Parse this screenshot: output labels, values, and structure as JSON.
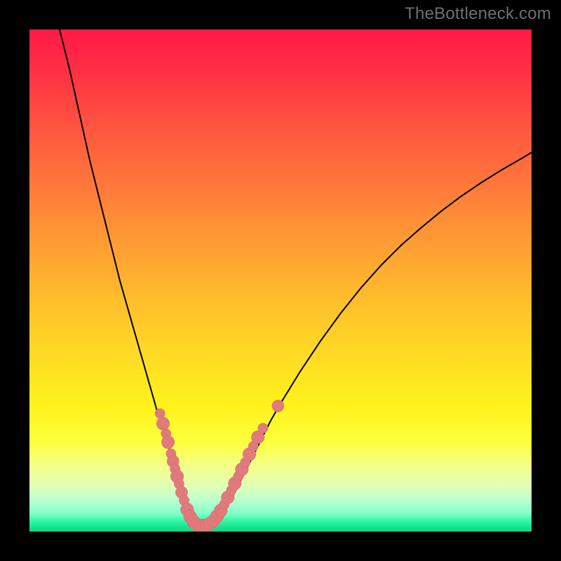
{
  "watermark": "TheBottleneck.com",
  "colors": {
    "frame": "#000000",
    "curve": "#000000",
    "marker_fill": "#e07a7c",
    "marker_stroke": "#d46b6d"
  },
  "chart_data": {
    "type": "line",
    "title": "",
    "xlabel": "",
    "ylabel": "",
    "xlim": [
      0,
      100
    ],
    "ylim": [
      0,
      100
    ],
    "grid": false,
    "legend": false,
    "series": [
      {
        "name": "curve",
        "comment": "V-shaped curve; y-values as percentage of plot height from bottom (0=bottom, 100=top). Minimum ≈ x=33, y≈1.",
        "x": [
          6,
          8,
          10,
          12,
          14,
          16,
          18,
          20,
          22,
          24,
          26,
          28,
          30,
          31,
          32,
          33,
          34,
          35,
          36,
          38,
          40,
          42,
          44,
          46,
          48,
          50,
          54,
          58,
          62,
          66,
          70,
          74,
          78,
          82,
          86,
          90,
          94,
          98,
          100
        ],
        "y": [
          100,
          92,
          83,
          74,
          66,
          58,
          50,
          43,
          36,
          29,
          22,
          16,
          9,
          6,
          3.5,
          1.5,
          1.2,
          1.2,
          1.5,
          3,
          6,
          10,
          14,
          18,
          22,
          25.5,
          32,
          38,
          43.5,
          48.5,
          53,
          57,
          60.5,
          63.8,
          66.8,
          69.5,
          72,
          74.3,
          75.5
        ]
      }
    ],
    "markers": {
      "comment": "salmon dot clusters along the V near the vertex and lower legs; same coordinate system as curve",
      "points": [
        {
          "x": 26.0,
          "y": 23.5,
          "r": 1.0
        },
        {
          "x": 26.6,
          "y": 21.5,
          "r": 1.3
        },
        {
          "x": 27.2,
          "y": 19.5,
          "r": 1.0
        },
        {
          "x": 27.6,
          "y": 17.8,
          "r": 1.3
        },
        {
          "x": 28.2,
          "y": 15.5,
          "r": 1.0
        },
        {
          "x": 28.6,
          "y": 14.0,
          "r": 1.2
        },
        {
          "x": 29.0,
          "y": 12.5,
          "r": 1.0
        },
        {
          "x": 29.4,
          "y": 11.0,
          "r": 1.3
        },
        {
          "x": 29.8,
          "y": 9.5,
          "r": 1.0
        },
        {
          "x": 30.3,
          "y": 7.8,
          "r": 1.2
        },
        {
          "x": 30.8,
          "y": 6.2,
          "r": 1.0
        },
        {
          "x": 31.4,
          "y": 4.4,
          "r": 1.3
        },
        {
          "x": 32.0,
          "y": 3.0,
          "r": 1.3
        },
        {
          "x": 32.6,
          "y": 2.0,
          "r": 1.3
        },
        {
          "x": 33.2,
          "y": 1.4,
          "r": 1.3
        },
        {
          "x": 33.9,
          "y": 1.2,
          "r": 1.3
        },
        {
          "x": 34.6,
          "y": 1.2,
          "r": 1.3
        },
        {
          "x": 35.3,
          "y": 1.3,
          "r": 1.3
        },
        {
          "x": 36.0,
          "y": 1.6,
          "r": 1.3
        },
        {
          "x": 36.7,
          "y": 2.2,
          "r": 1.3
        },
        {
          "x": 37.4,
          "y": 3.1,
          "r": 1.3
        },
        {
          "x": 38.1,
          "y": 4.2,
          "r": 1.3
        },
        {
          "x": 38.8,
          "y": 5.4,
          "r": 1.0
        },
        {
          "x": 39.5,
          "y": 6.8,
          "r": 1.3
        },
        {
          "x": 40.2,
          "y": 8.2,
          "r": 1.0
        },
        {
          "x": 40.9,
          "y": 9.6,
          "r": 1.3
        },
        {
          "x": 41.6,
          "y": 11.0,
          "r": 1.0
        },
        {
          "x": 42.3,
          "y": 12.4,
          "r": 1.3
        },
        {
          "x": 43.0,
          "y": 13.8,
          "r": 1.0
        },
        {
          "x": 43.8,
          "y": 15.4,
          "r": 1.3
        },
        {
          "x": 44.6,
          "y": 17.0,
          "r": 1.0
        },
        {
          "x": 45.5,
          "y": 18.8,
          "r": 1.3
        },
        {
          "x": 46.5,
          "y": 20.6,
          "r": 1.0
        },
        {
          "x": 49.5,
          "y": 25.0,
          "r": 1.2
        }
      ]
    }
  }
}
